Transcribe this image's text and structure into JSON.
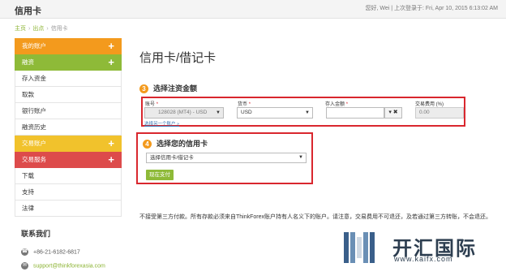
{
  "header": {
    "title": "信用卡",
    "user_info": "您好, Wei | 上次登录于: Fri, Apr 10, 2015 6:13:02 AM"
  },
  "breadcrumb": [
    "主页",
    "出点",
    "信用卡"
  ],
  "sidebar": {
    "items": [
      {
        "label": "我的账户",
        "color": "#f39a1d",
        "expandable": true
      },
      {
        "label": "融资",
        "color": "#8eba38",
        "expandable": true
      },
      {
        "label": "存入资金",
        "color": "#ffffff",
        "expandable": false
      },
      {
        "label": "取款",
        "color": "#ffffff",
        "expandable": false
      },
      {
        "label": "银行账户",
        "color": "#ffffff",
        "expandable": false
      },
      {
        "label": "融资历史",
        "color": "#ffffff",
        "expandable": false
      },
      {
        "label": "交易账户",
        "color": "#f1c22c",
        "expandable": true
      },
      {
        "label": "交易服务",
        "color": "#dd4b4b",
        "expandable": true
      },
      {
        "label": "下载",
        "color": "#ffffff",
        "expandable": false
      },
      {
        "label": "支持",
        "color": "#ffffff",
        "expandable": false
      },
      {
        "label": "法律",
        "color": "#ffffff",
        "expandable": false
      }
    ],
    "plus_symbol": "+"
  },
  "contact": {
    "title": "联系我们",
    "phone": "+86-21-6182-6817",
    "email": "support@thinkforexasia.com"
  },
  "main": {
    "page_title": "信用卡/借记卡",
    "step3": {
      "number": "3",
      "title": "选择注资金额",
      "account_label": "账号",
      "account_value": "128028 (MT4) - USD",
      "currency_label": "货币",
      "currency_value": "USD",
      "amount_label": "存入金额",
      "amount_value": "",
      "fee_label": "交易费用 (%)",
      "fee_value": "0.00",
      "select_other": "选择另一个账户 »",
      "required_mark": "*"
    },
    "step4": {
      "number": "4",
      "title": "选择您的信用卡",
      "card_select_value": "选择信用卡/借记卡",
      "pay_button": "现在支付"
    },
    "notice": "不接受第三方付款。所有存款必须来自ThinkForex账户持有人名义下的账户。请注意，交易费用不可退还，及若通过第三方转账，不会退还。"
  },
  "watermark": {
    "text": "开汇国际",
    "url": "www.kaifx.com"
  },
  "colors": {
    "accent_green": "#8eba38",
    "highlight_red": "#d9272e",
    "step_orange": "#f39a1d"
  }
}
